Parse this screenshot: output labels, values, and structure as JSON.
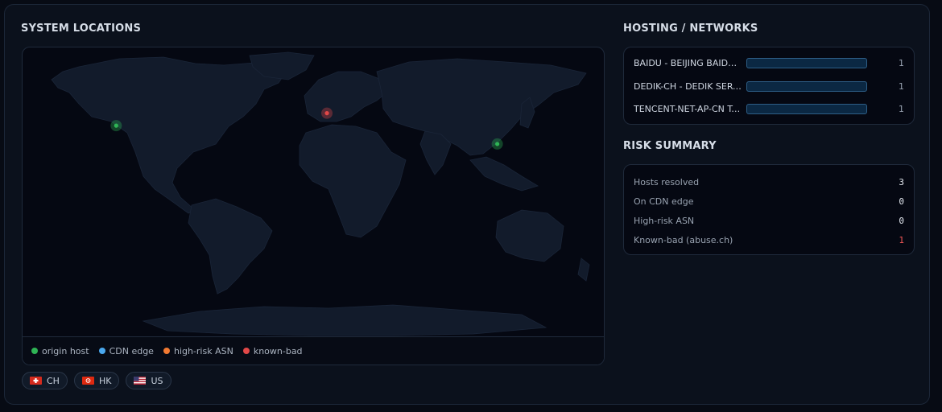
{
  "colors": {
    "origin": "#2fb455",
    "cdn": "#4aa8ee",
    "high_risk": "#f27a32",
    "known_bad": "#e24848",
    "bad_value": "#f05656"
  },
  "locations": {
    "title": "SYSTEM LOCATIONS",
    "markers": [
      {
        "kind": "origin",
        "lon": -122,
        "lat": 37
      },
      {
        "kind": "known_bad",
        "lon": 8.5,
        "lat": 47
      },
      {
        "kind": "origin",
        "lon": 114,
        "lat": 22.3
      }
    ],
    "legend": [
      {
        "label": "origin host",
        "color": "#2fb455"
      },
      {
        "label": "CDN edge",
        "color": "#4aa8ee"
      },
      {
        "label": "high-risk ASN",
        "color": "#f27a32"
      },
      {
        "label": "known-bad",
        "color": "#e24848"
      }
    ],
    "countries": [
      {
        "code": "CH",
        "flag": "ch-flag-icon"
      },
      {
        "code": "HK",
        "flag": "hk-flag-icon"
      },
      {
        "code": "US",
        "flag": "us-flag-icon"
      }
    ]
  },
  "hosting": {
    "title": "HOSTING / NETWORKS",
    "rows": [
      {
        "name": "BAIDU - BEIJING BAIDU NETCOM SCIENCE AND TECHNOLOGY",
        "count": "1",
        "fraction": 1.0
      },
      {
        "name": "DEDIK-CH - DEDIK SERVICES LIMITED",
        "count": "1",
        "fraction": 1.0
      },
      {
        "name": "TENCENT-NET-AP-CN Tencent Building",
        "count": "1",
        "fraction": 1.0
      }
    ]
  },
  "risk": {
    "title": "RISK SUMMARY",
    "rows": [
      {
        "label": "Hosts resolved",
        "value": "3",
        "bad": false
      },
      {
        "label": "On CDN edge",
        "value": "0",
        "bad": false
      },
      {
        "label": "High-risk ASN",
        "value": "0",
        "bad": false
      },
      {
        "label": "Known-bad (abuse.ch)",
        "value": "1",
        "bad": true
      }
    ]
  }
}
